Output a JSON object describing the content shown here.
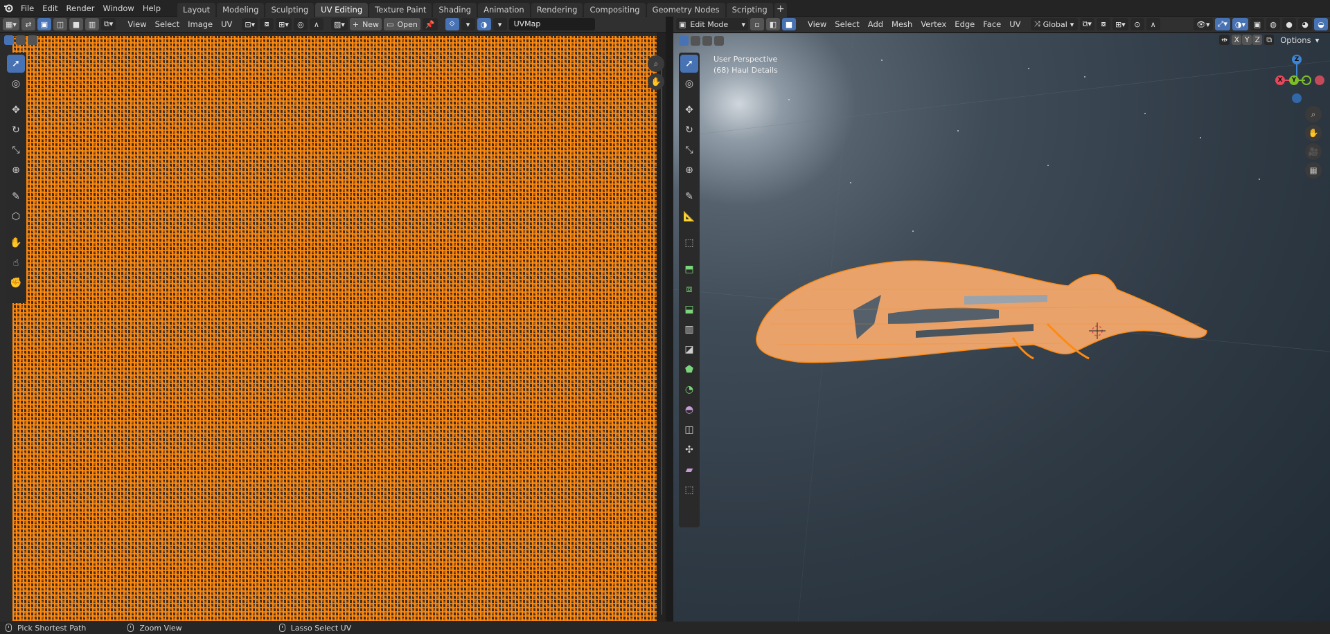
{
  "topbar": {
    "menus": [
      "File",
      "Edit",
      "Render",
      "Window",
      "Help"
    ],
    "workspaces": [
      "Layout",
      "Modeling",
      "Sculpting",
      "UV Editing",
      "Texture Paint",
      "Shading",
      "Animation",
      "Rendering",
      "Compositing",
      "Geometry Nodes",
      "Scripting"
    ],
    "active_workspace": "UV Editing",
    "add_label": "+"
  },
  "uv_header": {
    "menus": [
      "View",
      "Select",
      "Image",
      "UV"
    ],
    "new_label": "New",
    "open_label": "Open",
    "uvmap_value": "UVMap"
  },
  "vp_header": {
    "mode_label": "Edit Mode",
    "menus": [
      "View",
      "Select",
      "Add",
      "Mesh",
      "Vertex",
      "Edge",
      "Face",
      "UV"
    ],
    "orientation_label": "Global",
    "options_label": "Options",
    "axis_x": "X",
    "axis_y": "Y",
    "axis_z": "Z"
  },
  "viewport": {
    "view_name": "User Perspective",
    "object_label": "(68) Haul Details"
  },
  "gizmo": {
    "x": "X",
    "y": "Y",
    "z": "Z"
  },
  "status": {
    "left": "Pick Shortest Path",
    "middle": "Zoom View",
    "right": "Lasso Select UV"
  },
  "colors": {
    "accent": "#4772b3",
    "mesh_orange": "#ff8a10",
    "axis_x": "#e04a5c",
    "axis_y": "#7dbd2b",
    "axis_z": "#3c84d6"
  },
  "icons": {
    "uv_tools": [
      "select-box-icon",
      "cursor-icon",
      "move-icon",
      "rotate-icon",
      "scale-icon",
      "transform-icon",
      "annotate-icon",
      "rip-region-icon",
      "grab-icon",
      "relax-icon",
      "pinch-icon"
    ],
    "vp_tools": [
      "select-box-icon",
      "cursor-icon",
      "move-icon",
      "rotate-icon",
      "scale-icon",
      "transform-icon",
      "annotate-icon",
      "measure-icon",
      "add-cube-icon",
      "extrude-icon",
      "inset-icon",
      "bevel-icon",
      "loop-cut-icon",
      "knife-icon",
      "poly-build-icon",
      "spin-icon",
      "smooth-icon",
      "edge-slide-icon",
      "shrink-fatten-icon",
      "shear-icon",
      "rip-icon"
    ]
  }
}
